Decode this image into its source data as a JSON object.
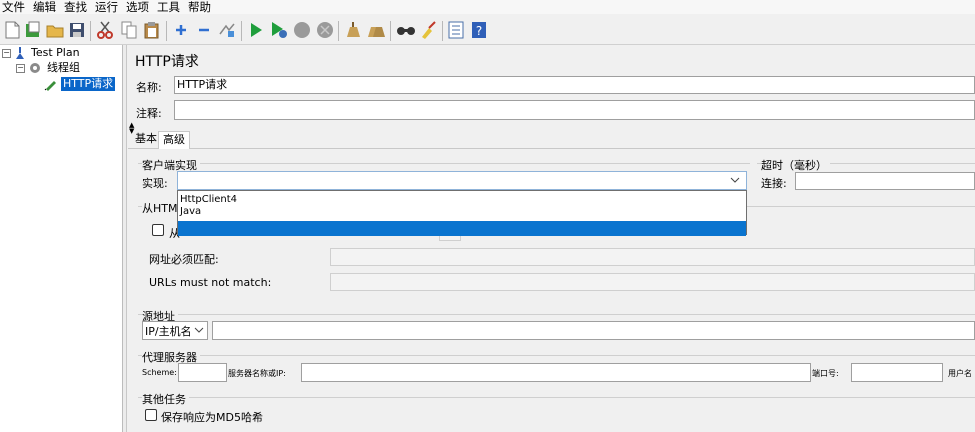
{
  "menu": [
    "文件",
    "编辑",
    "查找",
    "运行",
    "选项",
    "工具",
    "帮助"
  ],
  "toolbar_icons": [
    "new-icon",
    "templates-icon",
    "open-icon",
    "save-icon",
    "cut-icon",
    "copy-icon",
    "paste-icon",
    "expand-icon",
    "collapse-icon",
    "toggle-icon",
    "start-icon",
    "start-no-pause-icon",
    "stop-icon",
    "shutdown-icon",
    "clear-icon",
    "clear-all-icon",
    "search-icon",
    "reset-search-icon",
    "function-helper-icon",
    "help-icon"
  ],
  "tree": {
    "test_plan": "Test Plan",
    "thread_group": "线程组",
    "http_request": "HTTP请求"
  },
  "panel": {
    "title": "HTTP请求",
    "name_label": "名称:",
    "name_value": "HTTP请求",
    "comment_label": "注释:",
    "comment_value": ""
  },
  "tabs": [
    "基本",
    "高级"
  ],
  "client": {
    "section_label": "客户端实现",
    "impl_label": "实现:",
    "impl_value": "",
    "options": [
      "HttpClient4",
      "Java",
      ""
    ],
    "highlighted_index": 2
  },
  "timeout": {
    "section_label": "超时（毫秒）",
    "connect_label": "连接:",
    "connect_value": ""
  },
  "embedded": {
    "section_label_visible": "从HTM",
    "checkbox_label_visible": "从",
    "must_match_label": "网址必须匹配:",
    "must_not_match_label": "URLs must not match:"
  },
  "source": {
    "section_label": "源地址",
    "type_value": "IP/主机名",
    "address_value": ""
  },
  "proxy": {
    "section_label": "代理服务器",
    "scheme_label": "Scheme:",
    "server_label": "服务器名称或IP:",
    "port_label": "端口号:",
    "user_label": "用户名"
  },
  "other": {
    "section_label": "其他任务",
    "md5_label": "保存响应为MD5哈希"
  }
}
